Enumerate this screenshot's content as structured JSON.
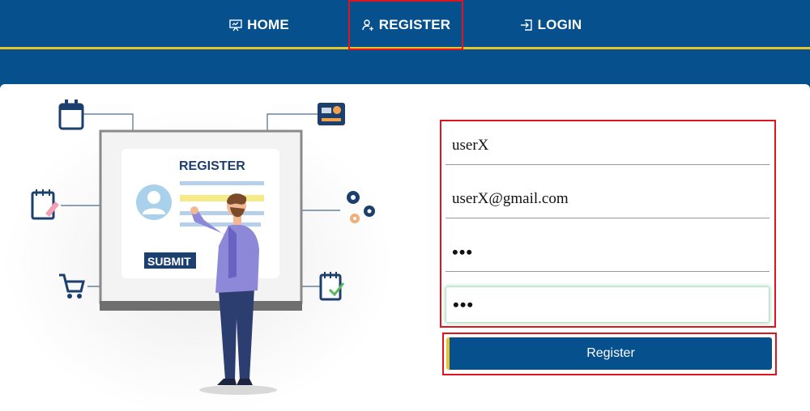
{
  "nav": {
    "home_label": "HOME",
    "register_label": "REGISTER",
    "login_label": "LOGIN"
  },
  "illustration": {
    "board_title": "REGISTER",
    "submit_label": "SUBMIT"
  },
  "form": {
    "username_value": "userX",
    "email_value": "userX@gmail.com",
    "password_display": "•••",
    "confirm_password_display": "•••",
    "submit_label": "Register"
  },
  "colors": {
    "brand_blue": "#05508d",
    "accent_yellow": "#e8c42a",
    "highlight_red": "#e0141e"
  }
}
